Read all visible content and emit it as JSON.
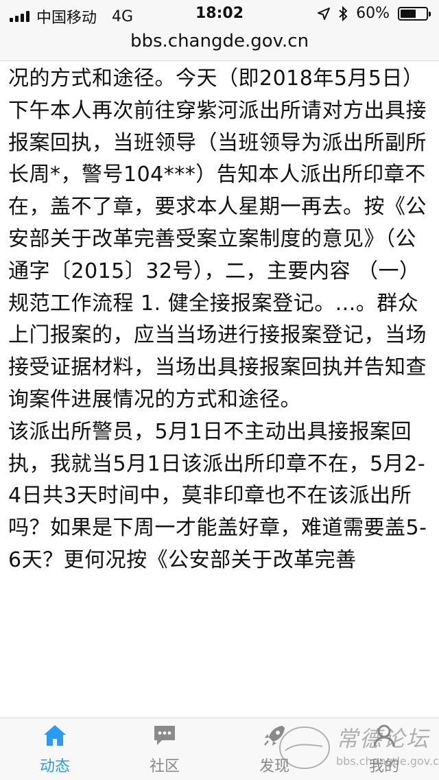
{
  "status_bar": {
    "carrier": "中国移动",
    "network": "4G",
    "time": "18:02",
    "battery_percent": "60%",
    "battery_level": 0.6
  },
  "address_bar": {
    "url": "bbs.changde.gov.cn"
  },
  "article": {
    "paragraphs": [
      "况的方式和途径。今天（即2018年5月5日）下午本人再次前往穿紫河派出所请对方出具接报案回执，当班领导（当班领导为派出所副所长周*，警号104***）告知本人派出所印章不在，盖不了章，要求本人星期一再去。按《公安部关于改革完善受案立案制度的意见》（公通字〔2015〕32号），二，主要内容  （一）规范工作流程  1. 健全接报案登记。...。群众上门报案的，应当当场进行接报案登记，当场接受证据材料，当场出具接报案回执并告知查询案件进展情况的方式和途径。",
      "该派出所警员，5月1日不主动出具接报案回执，我就当5月1日该派出所印章不在，5月2-4日共3天时间中，莫非印章也不在该派出所吗？如果是下周一才能盖好章，难道需要盖5-6天？更何况按《公安部关于改革完善"
    ]
  },
  "tab_bar": {
    "tabs": [
      {
        "label": "动态",
        "icon": "home-icon",
        "active": true
      },
      {
        "label": "社区",
        "icon": "chat-icon",
        "active": false
      },
      {
        "label": "发现",
        "icon": "rocket-icon",
        "active": false
      },
      {
        "label": "我的",
        "icon": "user-icon",
        "active": false
      }
    ]
  },
  "watermark": {
    "text": "常德论坛",
    "url_text": "bbs.changde.gov.cn"
  },
  "colors": {
    "accent": "#2a9bf5",
    "inactive": "#8a8a8a",
    "bar_bg": "#f7f7f7"
  }
}
